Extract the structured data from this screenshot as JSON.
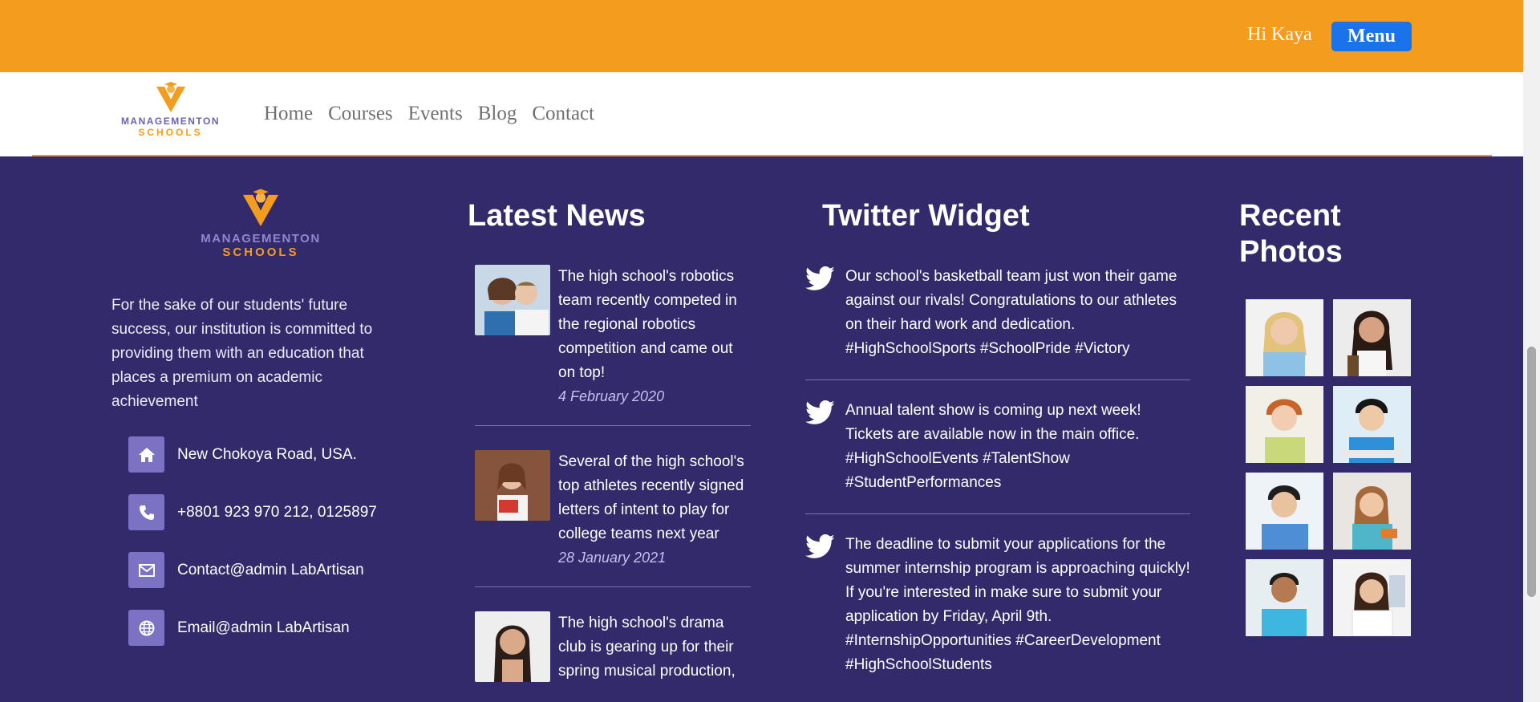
{
  "header": {
    "greeting": "Hi Kaya",
    "menu_label": "Menu"
  },
  "brand": {
    "line1": "MANAGEMENTON",
    "line2": "SCHOOLS"
  },
  "nav": {
    "items": [
      "Home",
      "Courses",
      "Events",
      "Blog",
      "Contact"
    ]
  },
  "about": {
    "text": "For the sake of our students' future success, our institution is committed to providing them with an education that places a premium on academic achievement"
  },
  "contact": [
    {
      "icon": "home-icon",
      "text": "New Chokoya Road, USA."
    },
    {
      "icon": "phone-icon",
      "text": "+8801 923 970 212, 0125897"
    },
    {
      "icon": "envelope-icon",
      "text": "Contact@admin LabArtisan"
    },
    {
      "icon": "globe-icon",
      "text": "Email@admin LabArtisan"
    }
  ],
  "news": {
    "title": "Latest News",
    "items": [
      {
        "text": "The high school's robotics team recently competed in the regional robotics competition and came out on top!",
        "date": "4 February 2020"
      },
      {
        "text": "Several of the high school's top athletes recently signed letters of intent to play for college teams next year",
        "date": "28 January 2021"
      },
      {
        "text": "The high school's drama club is gearing up for their spring musical production,",
        "date": ""
      }
    ]
  },
  "twitter": {
    "title": "Twitter Widget",
    "tweets": [
      "Our school's basketball team just won their game against our rivals! Congratulations to our athletes on their hard work and dedication. #HighSchoolSports #SchoolPride #Victory",
      "Annual talent show is coming up next week! Tickets are available now in the main office. #HighSchoolEvents #TalentShow #StudentPerformances",
      "The deadline to submit your applications for the summer internship program is approaching quickly! If you're interested in make sure to submit your application by Friday, April 9th. #InternshipOpportunities #CareerDevelopment #HighSchoolStudents"
    ]
  },
  "photos": {
    "title": "Recent Photos",
    "count_shown": 8
  },
  "colors": {
    "topbar": "#f39c1e",
    "footer": "#332a6b",
    "menu_button": "#1a73e8",
    "contact_icon_bg": "#7b72c4"
  }
}
